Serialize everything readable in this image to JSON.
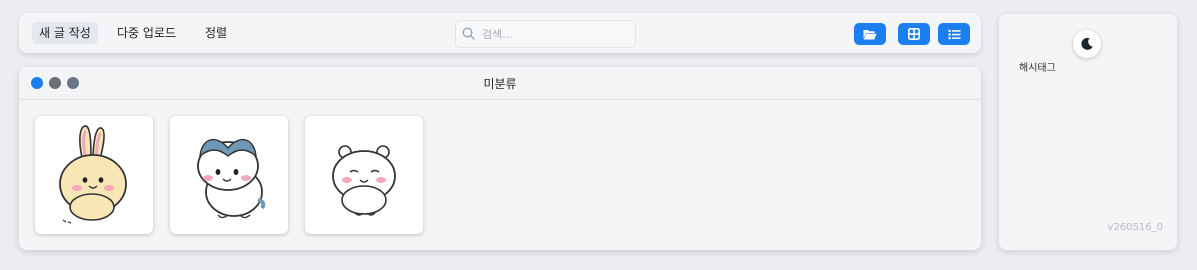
{
  "toolbar": {
    "new_post": "새 글 작성",
    "bulk_upload": "다중 업로드",
    "sort": "정렬",
    "search_placeholder": "검색...",
    "accent": "#1b7ff0",
    "icons": [
      "folder-open-icon",
      "grid-view-icon",
      "list-view-icon"
    ]
  },
  "window": {
    "title": "미분류",
    "dot_colors": [
      "#1b7ff0",
      "#6c6f73",
      "#6b7387"
    ],
    "items": [
      {
        "name": "usagi-character",
        "colors": {
          "body": "#f9e6b5",
          "cheek": "#f4a7b9"
        }
      },
      {
        "name": "hachiware-character",
        "colors": {
          "body": "#ffffff",
          "ears": "#6e98b5"
        }
      },
      {
        "name": "chiikawa-character",
        "colors": {
          "body": "#ffffff",
          "cheek": "#f4a7b9"
        }
      }
    ]
  },
  "sidebar": {
    "theme_icon": "moon-icon",
    "hashtag_label": "해시태그",
    "version": "v260516_0"
  }
}
